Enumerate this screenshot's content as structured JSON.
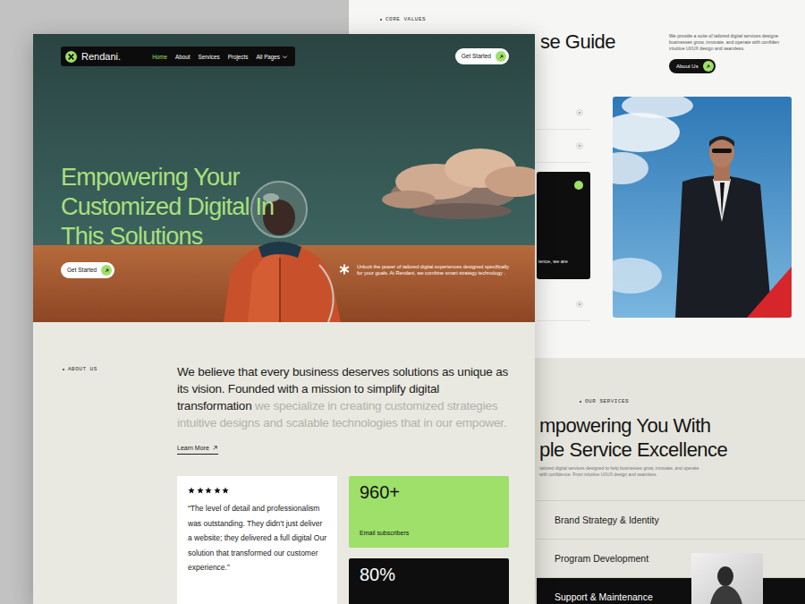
{
  "back_page": {
    "core_values": {
      "label": "CORE VALUES",
      "title": "se Guide",
      "intro_lines": [
        "We provide a suite of tailored digital services designe",
        "businesses grow, innovate, and operate with confiden",
        "intuitive UI/UX design and seamless."
      ],
      "button": "About Us",
      "items": [
        {
          "expanded": false
        },
        {
          "expanded": false
        },
        {
          "expanded": true,
          "text": "ience, we are"
        },
        {
          "expanded": false
        }
      ]
    },
    "services": {
      "label": "OUR SERVICES",
      "heading_lines": [
        "mpowering You With",
        "ple Service Excellence"
      ],
      "intro_lines": [
        "tailored digital services designed to help businesses grow, innovate, and operate",
        "with confidence. From intuitive UI/UX design and seamless."
      ],
      "items": [
        {
          "name": "Brand Strategy & Identity",
          "selected": false
        },
        {
          "name": "Program Development",
          "selected": false
        },
        {
          "name": "Support & Maintenance",
          "selected": true
        }
      ]
    }
  },
  "front_page": {
    "nav": {
      "brand": "Rendani.",
      "links": [
        {
          "label": "Home",
          "selected": true,
          "dropdown": false
        },
        {
          "label": "About",
          "selected": false,
          "dropdown": false
        },
        {
          "label": "Services",
          "selected": false,
          "dropdown": false
        },
        {
          "label": "Projects",
          "selected": false,
          "dropdown": false
        },
        {
          "label": "All Pages",
          "selected": false,
          "dropdown": true
        }
      ],
      "cta": "Get Started"
    },
    "hero": {
      "headline_lines": [
        "Empowering Your",
        "Customized Digital In",
        "This Solutions"
      ],
      "cta": "Get Started",
      "description_lines": [
        "Unlock the power of tailored digital experiences designed specifically",
        "for your goals. At Rendani, we combine smart strategy technology ."
      ]
    },
    "about": {
      "label": "ABOUT US",
      "lead": "We believe that every business deserves solutions as unique as its vision. Founded with a mission to simplify digital transformation",
      "rest": " we specialize in creating customized strategies intuitive designs and scalable technologies that in our empower.",
      "link": "Learn More"
    },
    "testimonial": {
      "stars": 5,
      "quote": "“The level of detail and professionalism was outstanding. They didn't just deliver a website; they delivered a full digital Our solution that transformed our  customer experience.”"
    },
    "stats": [
      {
        "value": "960+",
        "label": "Email subscribers",
        "color": "#9ee06a"
      },
      {
        "value": "80%",
        "color": "#0e0e0e"
      }
    ]
  }
}
